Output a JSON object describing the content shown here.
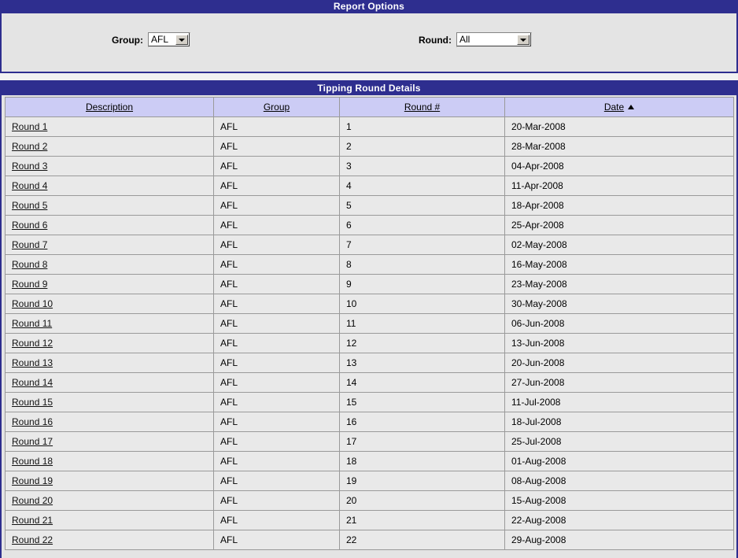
{
  "report_options": {
    "title": "Report Options",
    "group": {
      "label": "Group:",
      "value": "AFL",
      "arrow_icon": "chevron-down-icon"
    },
    "round": {
      "label": "Round:",
      "value": "All",
      "arrow_icon": "chevron-down-icon"
    }
  },
  "details": {
    "title": "Tipping Round Details",
    "columns": [
      {
        "key": "description",
        "label": "Description",
        "sortable": true,
        "sort": ""
      },
      {
        "key": "group",
        "label": "Group",
        "sortable": true,
        "sort": ""
      },
      {
        "key": "round_no",
        "label": "Round #",
        "sortable": true,
        "sort": ""
      },
      {
        "key": "date",
        "label": "Date",
        "sortable": true,
        "sort": "asc"
      }
    ],
    "sort_asc_icon": "triangle-up-icon",
    "rows": [
      {
        "description": "Round 1",
        "group": "AFL",
        "round_no": "1",
        "date": "20-Mar-2008"
      },
      {
        "description": "Round 2",
        "group": "AFL",
        "round_no": "2",
        "date": "28-Mar-2008"
      },
      {
        "description": "Round 3",
        "group": "AFL",
        "round_no": "3",
        "date": "04-Apr-2008"
      },
      {
        "description": "Round 4",
        "group": "AFL",
        "round_no": "4",
        "date": "11-Apr-2008"
      },
      {
        "description": "Round 5",
        "group": "AFL",
        "round_no": "5",
        "date": "18-Apr-2008"
      },
      {
        "description": "Round 6",
        "group": "AFL",
        "round_no": "6",
        "date": "25-Apr-2008"
      },
      {
        "description": "Round 7",
        "group": "AFL",
        "round_no": "7",
        "date": "02-May-2008"
      },
      {
        "description": "Round 8",
        "group": "AFL",
        "round_no": "8",
        "date": "16-May-2008"
      },
      {
        "description": "Round 9",
        "group": "AFL",
        "round_no": "9",
        "date": "23-May-2008"
      },
      {
        "description": "Round 10",
        "group": "AFL",
        "round_no": "10",
        "date": "30-May-2008"
      },
      {
        "description": "Round 11",
        "group": "AFL",
        "round_no": "11",
        "date": "06-Jun-2008"
      },
      {
        "description": "Round 12",
        "group": "AFL",
        "round_no": "12",
        "date": "13-Jun-2008"
      },
      {
        "description": "Round 13",
        "group": "AFL",
        "round_no": "13",
        "date": "20-Jun-2008"
      },
      {
        "description": "Round 14",
        "group": "AFL",
        "round_no": "14",
        "date": "27-Jun-2008"
      },
      {
        "description": "Round 15",
        "group": "AFL",
        "round_no": "15",
        "date": "11-Jul-2008"
      },
      {
        "description": "Round 16",
        "group": "AFL",
        "round_no": "16",
        "date": "18-Jul-2008"
      },
      {
        "description": "Round 17",
        "group": "AFL",
        "round_no": "17",
        "date": "25-Jul-2008"
      },
      {
        "description": "Round 18",
        "group": "AFL",
        "round_no": "18",
        "date": "01-Aug-2008"
      },
      {
        "description": "Round 19",
        "group": "AFL",
        "round_no": "19",
        "date": "08-Aug-2008"
      },
      {
        "description": "Round 20",
        "group": "AFL",
        "round_no": "20",
        "date": "15-Aug-2008"
      },
      {
        "description": "Round 21",
        "group": "AFL",
        "round_no": "21",
        "date": "22-Aug-2008"
      },
      {
        "description": "Round 22",
        "group": "AFL",
        "round_no": "22",
        "date": "29-Aug-2008"
      }
    ]
  },
  "theme": {
    "panel_header_bg": "#2e2e8f",
    "panel_header_fg": "#ffffff",
    "panel_body_bg": "#e4e4e4",
    "column_header_bg": "#ccccf5",
    "row_bg": "#e9e9e9",
    "grid_line": "#9a9a9a",
    "link_fg": "#111111"
  }
}
